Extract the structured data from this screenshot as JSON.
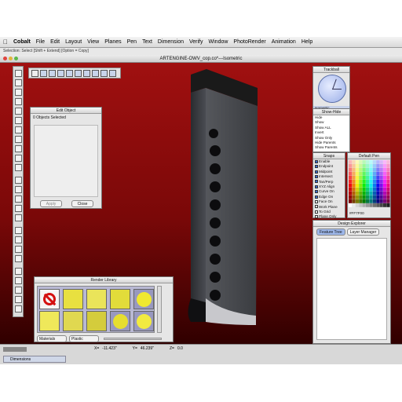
{
  "menubar": {
    "app_name": "Cobalt",
    "items": [
      "File",
      "Edit",
      "Layout",
      "View",
      "Planes",
      "Pen",
      "Text",
      "Dimension",
      "Verify",
      "Window",
      "PhotoRender",
      "Animation",
      "Help"
    ]
  },
  "status_hint": "Selection: Select [Shift + Extend] [Option = Copy]",
  "window_title": "ARTENGINE-OWV_cop.co*---Isometric",
  "edit_object": {
    "title": "Edit Object",
    "selection_text": "0 Objects Selected",
    "apply_label": "Apply",
    "close_label": "Close"
  },
  "trackball": {
    "title": "Trackball",
    "mode": "Isometric"
  },
  "show_hide": {
    "title": "Show-Hide",
    "items": [
      "Hide",
      "Show",
      "Show ALL",
      "Invert",
      "Show Only",
      "Hide Parents",
      "Show Parents"
    ]
  },
  "snaps": {
    "title": "Snaps",
    "items": [
      {
        "label": "Enable",
        "checked": true
      },
      {
        "label": "Endpoint",
        "checked": true
      },
      {
        "label": "Midpoint",
        "checked": true
      },
      {
        "label": "Intersect",
        "checked": true
      },
      {
        "label": "Tan/Perp",
        "checked": true
      },
      {
        "label": "XYZ Align",
        "checked": true
      },
      {
        "label": "Curve On",
        "checked": true
      },
      {
        "label": "Edge On",
        "checked": true
      },
      {
        "label": "Face On",
        "checked": false
      },
      {
        "label": "Work Plane",
        "checked": false
      },
      {
        "label": "To Grid",
        "checked": false
      },
      {
        "label": "Plane Only",
        "checked": false
      }
    ]
  },
  "default_pen": {
    "title": "Default Pen",
    "color_value": "#FF7F00"
  },
  "design_explorer": {
    "title": "Design Explorer",
    "tabs": [
      "Feature Tree",
      "Layer Manager"
    ]
  },
  "render_library": {
    "title": "Render Library",
    "category": "Materials",
    "subcategory": "Plastic"
  },
  "coords": {
    "x_label": "X=",
    "x_value": "-11.423\"",
    "y_label": "Y=",
    "y_value": "46.239\"",
    "z_label": "Z=",
    "z_value": "0.0"
  },
  "taskbar": {
    "item": "Dimensions"
  },
  "colors": {
    "viewport_top": "#a01010",
    "viewport_bottom": "#300000",
    "object_body": "#3a3c40"
  }
}
